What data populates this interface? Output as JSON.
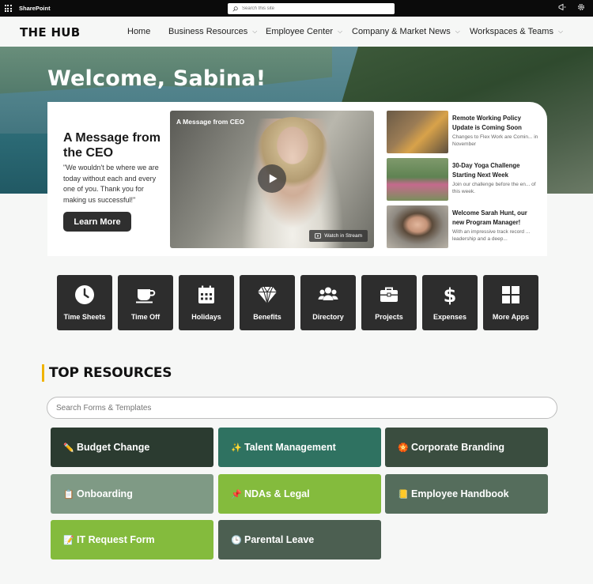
{
  "suitebar": {
    "app_name": "SharePoint",
    "search_placeholder": "Search this site"
  },
  "nav": {
    "logo": "THE HUB",
    "items": [
      {
        "label": "Home"
      },
      {
        "label": "Business Resources"
      },
      {
        "label": "Employee Center"
      },
      {
        "label": "Company & Market News"
      },
      {
        "label": "Workspaces & Teams"
      }
    ]
  },
  "hero": {
    "welcome": "Welcome, Sabina!",
    "ceo_title": "A Message from the CEO",
    "ceo_quote": "\"We wouldn't be where we are today without each and every one of you. Thank you for making us successful!\"",
    "learn_more": "Learn More",
    "video_label": "A Message from CEO",
    "watch_label": "Watch in Stream"
  },
  "news": [
    {
      "title": "Remote Working Policy Update is Coming Soon",
      "desc": "Changes to Flex Work are Comin... in November"
    },
    {
      "title": "30-Day Yoga Challenge Starting Next Week",
      "desc": "Join our challenge before the en... of this week."
    },
    {
      "title": "Welcome Sarah Hunt, our new Program Manager!",
      "desc": "With an impressive track record ... leadership and a deep..."
    }
  ],
  "apps": [
    {
      "label": "Time Sheets",
      "icon": "clock-icon"
    },
    {
      "label": "Time Off",
      "icon": "coffee-cup-icon"
    },
    {
      "label": "Holidays",
      "icon": "calendar-icon"
    },
    {
      "label": "Benefits",
      "icon": "diamond-icon"
    },
    {
      "label": "Directory",
      "icon": "people-icon"
    },
    {
      "label": "Projects",
      "icon": "briefcase-icon"
    },
    {
      "label": "Expenses",
      "icon": "dollar-icon"
    },
    {
      "label": "More Apps",
      "icon": "grid-icon"
    }
  ],
  "resources": {
    "title": "TOP RESOURCES",
    "search_placeholder": "Search Forms & Templates",
    "items": [
      {
        "label": "Budget Change",
        "emoji": "✏️",
        "color": "#2b3b30"
      },
      {
        "label": "Talent Management",
        "emoji": "✨",
        "color": "#2f7261"
      },
      {
        "label": "Corporate Branding",
        "emoji": "🏵️",
        "color": "#3a4d3f"
      },
      {
        "label": "Onboarding",
        "emoji": "📋",
        "color": "#7f9a85"
      },
      {
        "label": "NDAs & Legal",
        "emoji": "📌",
        "color": "#84bb3d"
      },
      {
        "label": "Employee Handbook",
        "emoji": "📒",
        "color": "#556d5c"
      },
      {
        "label": "IT Request Form",
        "emoji": "📝",
        "color": "#84bb3d"
      },
      {
        "label": "Parental Leave",
        "emoji": "🕒",
        "color": "#4c5f51"
      }
    ]
  },
  "colors": {
    "accent_bar": "#f0b400",
    "tile_bg": "#2d2d2d",
    "suitebar_bg": "#0b0b0b"
  }
}
